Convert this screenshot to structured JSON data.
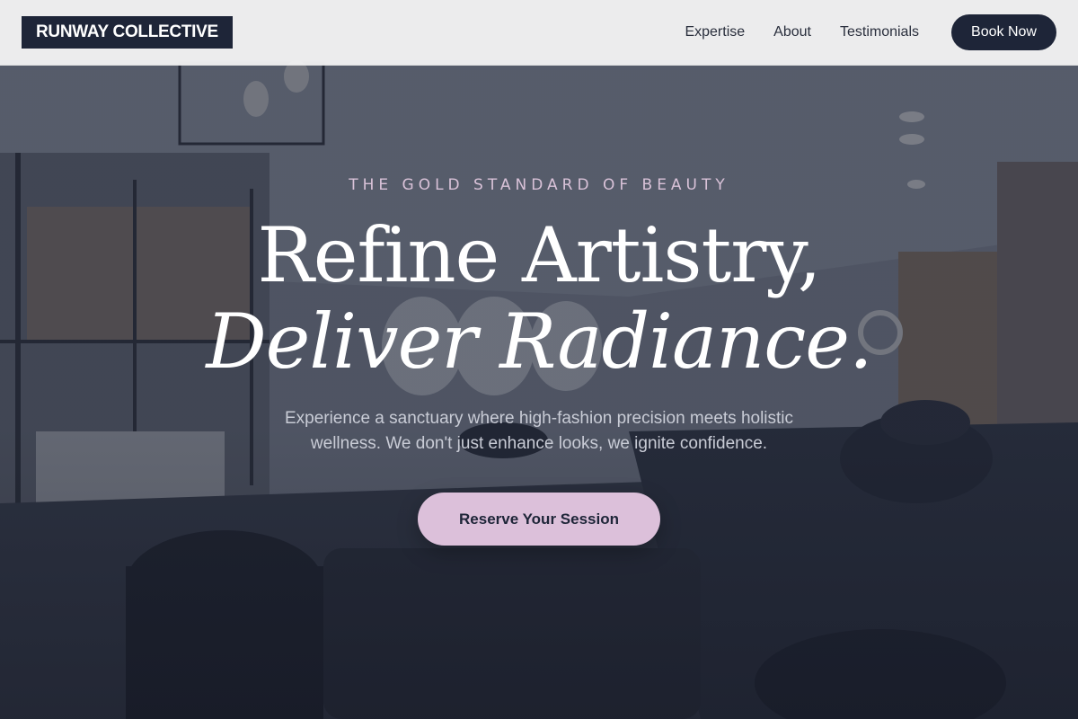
{
  "header": {
    "logo": "RUNWAY COLLECTIVE",
    "nav": [
      "Expertise",
      "About",
      "Testimonials"
    ],
    "cta": "Book Now"
  },
  "hero": {
    "eyebrow": "THE GOLD STANDARD OF BEAUTY",
    "headline_line1": "Refine Artistry,",
    "headline_line2": "Deliver Radiance.",
    "subtext": "Experience a sanctuary where high-fashion precision meets holistic wellness. We don't just enhance looks, we ignite confidence.",
    "cta": "Reserve Your Session"
  },
  "colors": {
    "navy": "#1e2538",
    "accent_pink": "#dcc0da",
    "header_bg": "#f3f3f3",
    "eyebrow": "#d9c2d8"
  }
}
